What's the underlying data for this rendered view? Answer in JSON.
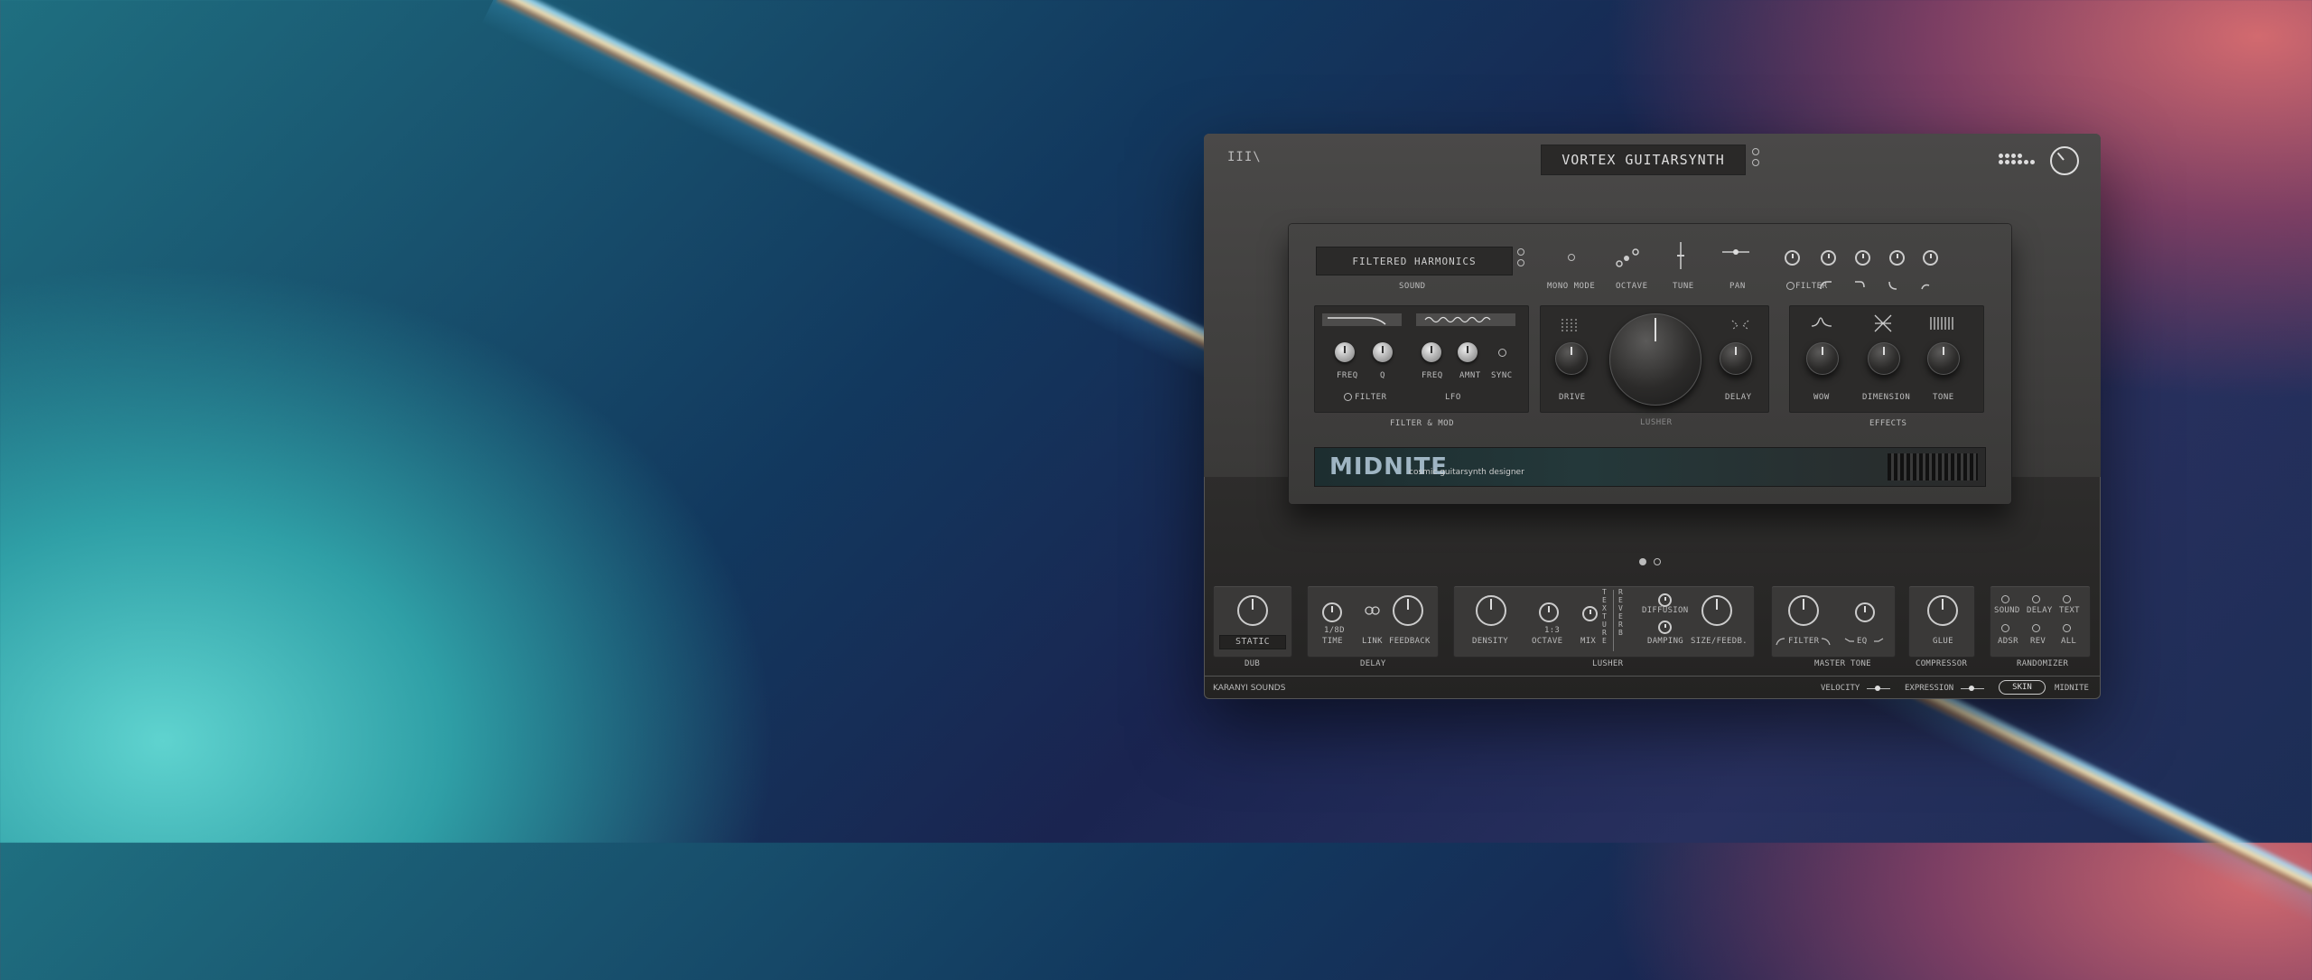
{
  "header": {
    "logo": "III\\",
    "preset_title": "VORTEX GUITARSYNTH"
  },
  "top_row": {
    "sound_value": "FILTERED HARMONICS",
    "sound_label": "SOUND",
    "mono_mode": "MONO MODE",
    "octave": "OCTAVE",
    "tune": "TUNE",
    "pan": "PAN",
    "filter": "FILTER"
  },
  "filter_mod": {
    "freq1": "FREQ",
    "q": "Q",
    "freq2": "FREQ",
    "amnt": "AMNT",
    "sync": "SYNC",
    "filter": "FILTER",
    "lfo": "LFO",
    "section_label": "FILTER & MOD"
  },
  "lusher": {
    "drive": "DRIVE",
    "delay": "DELAY",
    "name": "LUSHER"
  },
  "effects": {
    "wow": "WOW",
    "dimension": "DIMENSION",
    "tone": "TONE",
    "section_label": "EFFECTS"
  },
  "banner": {
    "title": "MIDNITE",
    "subtitle": "cosmic guitarsynth designer"
  },
  "bottom": {
    "dub_value": "STATIC",
    "dub_label": "DUB",
    "delay_time_value": "1/8D",
    "delay_time": "TIME",
    "delay_link": "LINK",
    "delay_feedback": "FEEDBACK",
    "delay_label": "DELAY",
    "density": "DENSITY",
    "octave_value": "1:3",
    "octave": "OCTAVE",
    "mix": "MIX",
    "texture": "TEXTURE",
    "reverb": "REVERB",
    "diffusion": "DIFFUSION",
    "damping": "DAMPING",
    "size_feedb": "SIZE/FEEDB.",
    "lusher_label": "LUSHER",
    "filter": "FILTER",
    "eq": "EQ",
    "master_tone_label": "MASTER TONE",
    "glue": "GLUE",
    "compressor_label": "COMPRESSOR",
    "rand_sound": "SOUND",
    "rand_delay": "DELAY",
    "rand_text": "TEXT",
    "rand_adsr": "ADSR",
    "rand_rev": "REV",
    "rand_all": "ALL",
    "randomizer_label": "RANDOMIZER"
  },
  "footer": {
    "brand": "KARANYI SOUNDS",
    "velocity": "VELOCITY",
    "expression": "EXPRESSION",
    "skin": "SKIN",
    "skin_name": "MIDNITE"
  }
}
